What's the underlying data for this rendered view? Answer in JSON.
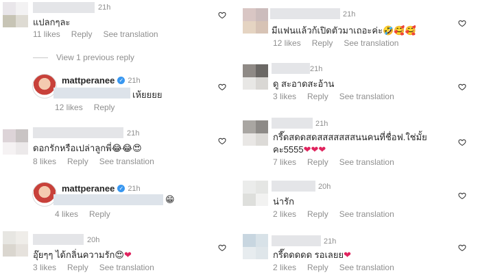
{
  "left": {
    "comments": [
      {
        "time": "21h",
        "text": "แปลกๆละ",
        "likes": "11 likes",
        "reply": "Reply",
        "translate": "See translation"
      },
      {
        "time": "21h",
        "text": "ดอกรักหรือเปล่าลูกพี่😂😂😍",
        "likes": "8 likes",
        "reply": "Reply",
        "translate": "See translation"
      },
      {
        "time": "20h",
        "text": "อุ๊ยๆๆ ได้กลิ่นความรัก😍",
        "likes": "3 likes",
        "reply": "Reply",
        "translate": "See translation"
      }
    ],
    "view_replies": "View 1 previous reply",
    "replies": [
      {
        "username": "mattperanee",
        "verified": "✓",
        "time": "21h",
        "text": "เห้ยยยย",
        "likes": "12 likes",
        "reply": "Reply"
      },
      {
        "username": "mattperanee",
        "verified": "✓",
        "time": "21h",
        "text": "😁",
        "likes": "4 likes",
        "reply": "Reply"
      }
    ]
  },
  "right": {
    "comments": [
      {
        "time": "21h",
        "text": "มีแฟนแล้วก้เปิดตัวมาเถอะค่ะ🤣🥰🥰",
        "likes": "12 likes",
        "reply": "Reply",
        "translate": "See translation"
      },
      {
        "time": "21h",
        "text": "ดู สะอาดสะอ้าน",
        "likes": "3 likes",
        "reply": "Reply",
        "translate": "See translation"
      },
      {
        "time": "21h",
        "text_line1": "กรี๊ดสดดสดสสสสสสสนนคนที่ชื่อฟ.ใช่มั้ย",
        "text_line2": "คะ5555",
        "likes": "7 likes",
        "reply": "Reply",
        "translate": "See translation"
      },
      {
        "time": "20h",
        "text": "น่ารัก",
        "likes": "2 likes",
        "reply": "Reply",
        "translate": "See translation"
      },
      {
        "time": "21h",
        "text": "กรี๊ดดดดด รอเลยย",
        "likes": "2 likes",
        "reply": "Reply",
        "translate": "See translation"
      }
    ]
  },
  "icons": {
    "like": "heart-outline-icon",
    "verified": "verified-badge-icon"
  },
  "colors": {
    "text": "#262626",
    "meta": "#8e8e8e",
    "verified": "#3897f0",
    "heart": "#e0245e"
  }
}
